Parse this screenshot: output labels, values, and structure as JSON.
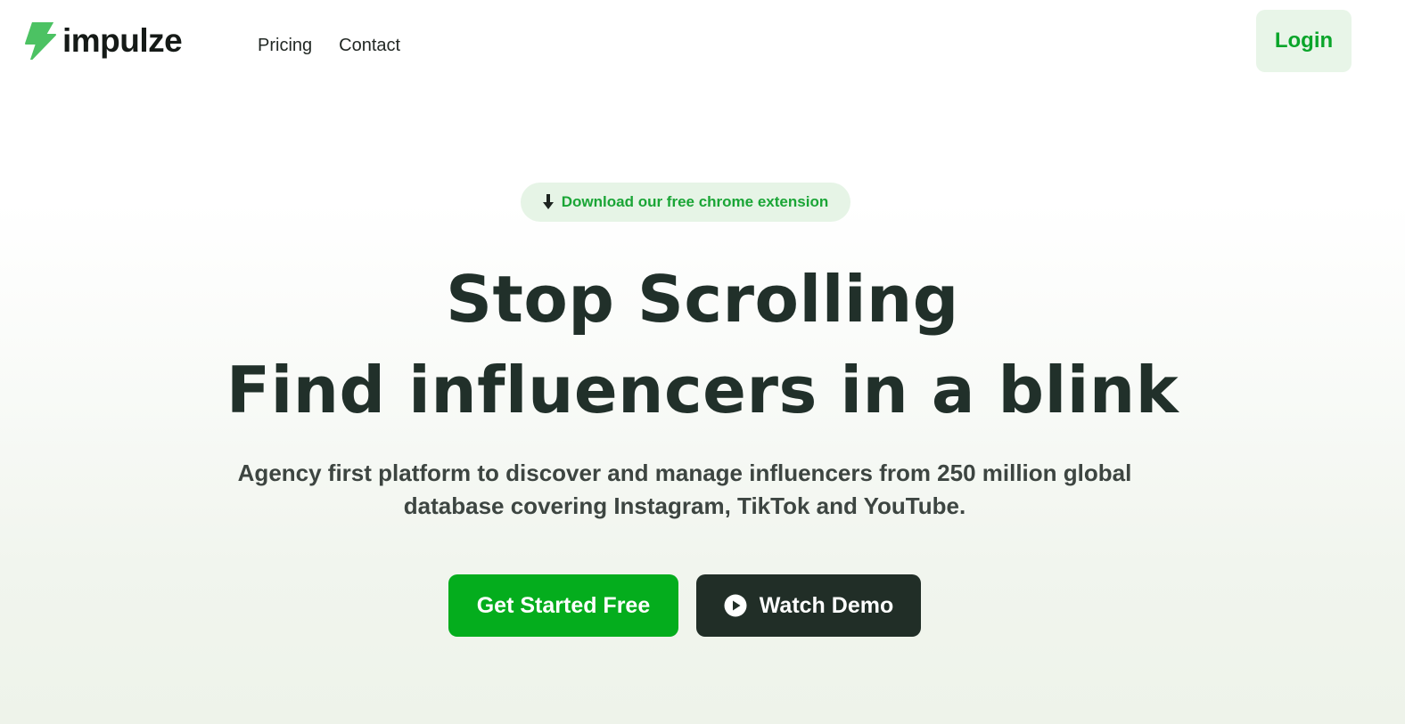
{
  "brand": {
    "name": "impulze",
    "icon": "lightning-bolt-icon",
    "accent_color": "#4cc263"
  },
  "nav": {
    "items": [
      {
        "label": "Pricing"
      },
      {
        "label": "Contact"
      }
    ]
  },
  "header": {
    "login_label": "Login"
  },
  "hero": {
    "extension_badge": {
      "icon": "download-arrow-icon",
      "label": "Download our free chrome extension"
    },
    "headline_line1": "Stop Scrolling",
    "headline_line2": "Find influencers in a blink",
    "subtitle": "Agency first platform to discover and manage influencers from 250 million global database covering Instagram, TikTok and YouTube.",
    "primary_cta": "Get Started Free",
    "secondary_cta": {
      "icon": "play-circle-icon",
      "label": "Watch Demo"
    }
  },
  "colors": {
    "primary_green": "#04ad1d",
    "dark": "#212e27",
    "login_bg": "#e8f5e8",
    "login_text": "#0aa52a",
    "badge_text": "#1aa536"
  }
}
